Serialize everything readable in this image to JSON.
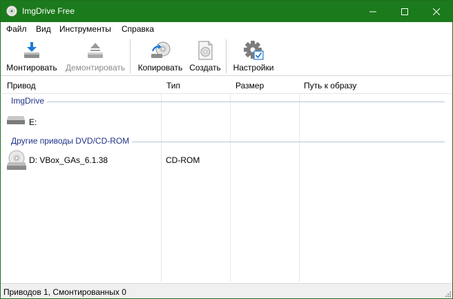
{
  "window": {
    "title": "ImgDrive Free",
    "accent": "#1b7a1b"
  },
  "menu": {
    "file": "Файл",
    "view": "Вид",
    "tools": "Инструменты",
    "help": "Справка"
  },
  "toolbar": {
    "mount": "Монтировать",
    "unmount": "Демонтировать",
    "copy": "Копировать",
    "create": "Создать",
    "settings": "Настройки"
  },
  "columns": {
    "drive": "Привод",
    "type": "Тип",
    "size": "Размер",
    "path": "Путь к образу"
  },
  "groups": [
    {
      "label": "ImgDrive",
      "rows": [
        {
          "name": "E:",
          "type": "",
          "size": "",
          "path": "",
          "icon": "hard-drive-icon"
        }
      ]
    },
    {
      "label": "Другие приводы DVD/CD-ROM",
      "rows": [
        {
          "name": "D: VBox_GAs_6.1.38",
          "type": "CD-ROM",
          "size": "",
          "path": "",
          "icon": "cd-drive-icon"
        }
      ]
    }
  ],
  "status": {
    "text": "Приводов 1, Смонтированных 0"
  }
}
